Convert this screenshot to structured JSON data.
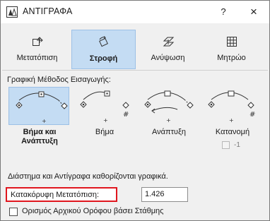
{
  "window": {
    "title": "ΑΝΤΙΓΡΑΦΑ",
    "help": "?",
    "close": "×"
  },
  "tabs": [
    {
      "label": "Μετατόπιση",
      "icon": "move-icon",
      "active": false
    },
    {
      "label": "Στροφή",
      "icon": "rotate-icon",
      "active": true
    },
    {
      "label": "Ανύψωση",
      "icon": "elevate-icon",
      "active": false
    },
    {
      "label": "Μητρώο",
      "icon": "matrix-icon",
      "active": false
    }
  ],
  "method_section": {
    "label": "Γραφική Μέθοδος Εισαγωγής:",
    "options": [
      {
        "label": "Βήμα και Ανάπτυξη",
        "selected": true
      },
      {
        "label": "Βήμα",
        "selected": false
      },
      {
        "label": "Ανάπτυξη",
        "selected": false
      },
      {
        "label": "Κατανομή",
        "selected": false
      }
    ],
    "count_value": "-1"
  },
  "info_text": "Διάστημα και Αντίγραφα καθορίζονται γραφικά.",
  "vertical_offset": {
    "label": "Κατακόρυφη Μετατόπιση:",
    "value": "1.426"
  },
  "floor_option": {
    "label": "Ορισμός Αρχικού Ορόφου βάσει Στάθμης",
    "checked": false
  },
  "colors": {
    "active_tab_bg": "#c4dcf3",
    "highlight_border": "#e0161e"
  }
}
